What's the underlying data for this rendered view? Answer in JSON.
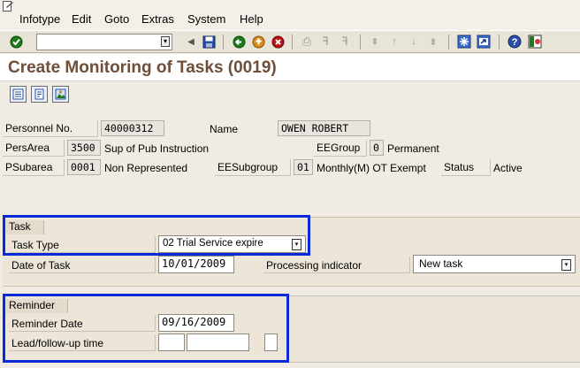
{
  "menu": {
    "items": [
      {
        "label": "Infotype"
      },
      {
        "label": "Edit"
      },
      {
        "label": "Goto"
      },
      {
        "label": "Extras"
      },
      {
        "label": "System"
      },
      {
        "label": "Help"
      }
    ]
  },
  "toolbar": {
    "command_value": "",
    "icons": [
      "enter-icon",
      "save-icon",
      "back-icon",
      "exit-icon",
      "cancel-icon",
      "print-icon",
      "find-icon",
      "find-next-icon",
      "first-page-icon",
      "previous-page-icon",
      "next-page-icon",
      "last-page-icon",
      "create-session-icon",
      "shortcut-icon",
      "help-icon",
      "layout-icon"
    ]
  },
  "title": "Create Monitoring of Tasks (0019)",
  "header": {
    "personnel_no_label": "Personnel No.",
    "personnel_no": "40000312",
    "name_label": "Name",
    "name": "OWEN ROBERT",
    "persarea_label": "PersArea",
    "persarea_code": "3500",
    "persarea_text": "Sup of Pub Instruction",
    "eegroup_label": "EEGroup",
    "eegroup_code": "0",
    "eegroup_text": "Permanent",
    "psubarea_label": "PSubarea",
    "psubarea_code": "0001",
    "psubarea_text": "Non Represented",
    "eesubgroup_label": "EESubgroup",
    "eesubgroup_code": "01",
    "eesubgroup_text": "Monthly(M) OT Exempt",
    "status_label": "Status",
    "status_value": "Active"
  },
  "task": {
    "group_title": "Task",
    "task_type_label": "Task Type",
    "task_type_value": "02 Trial Service expire",
    "date_label": "Date of Task",
    "date_value": "10/01/2009",
    "processing_label": "Processing indicator",
    "processing_value": "New task"
  },
  "reminder": {
    "group_title": "Reminder",
    "date_label": "Reminder Date",
    "date_value": "09/16/2009",
    "lead_label": "Lead/follow-up time",
    "lead_value": "",
    "lead_unit": "",
    "lead_sign": ""
  },
  "colors": {
    "highlight": "#0a2ad8",
    "title": "#6f4f3a"
  }
}
